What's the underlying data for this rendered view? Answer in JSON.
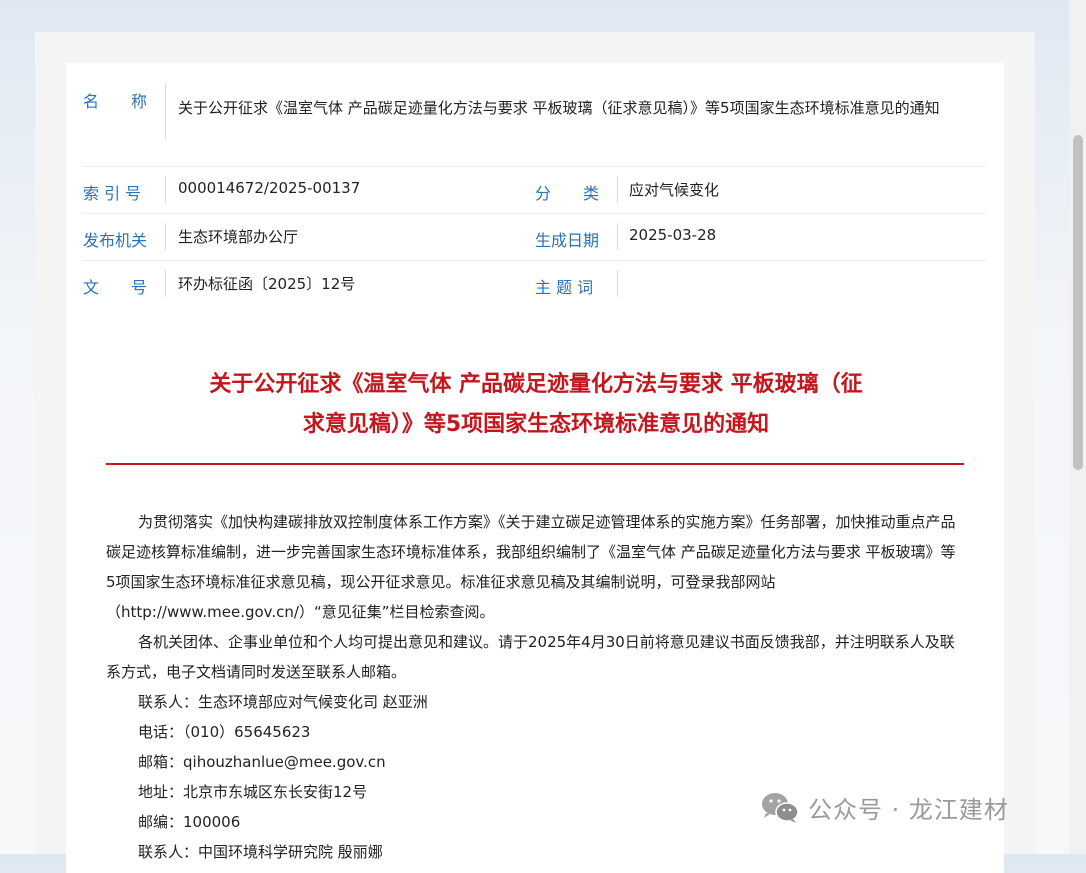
{
  "meta": {
    "name_label": "名　　称",
    "name_value": "关于公开征求《温室气体 产品碳足迹量化方法与要求 平板玻璃（征求意见稿）》等5项国家生态环境标准意见的通知",
    "index_label": "索 引 号",
    "index_value": "000014672/2025-00137",
    "category_label": "分　　类",
    "category_value": "应对气候变化",
    "issuer_label": "发布机关",
    "issuer_value": "生态环境部办公厅",
    "date_label": "生成日期",
    "date_value": "2025-03-28",
    "docno_label": "文　　号",
    "docno_value": "环办标征函〔2025〕12号",
    "subject_label": "主 题 词",
    "subject_value": ""
  },
  "document": {
    "title_line1": "关于公开征求《温室气体 产品碳足迹量化方法与要求 平板玻璃（征",
    "title_line2": "求意见稿）》等5项国家生态环境标准意见的通知",
    "para1": "为贯彻落实《加快构建碳排放双控制度体系工作方案》《关于建立碳足迹管理体系的实施方案》任务部署，加快推动重点产品碳足迹核算标准编制，进一步完善国家生态环境标准体系，我部组织编制了《温室气体 产品碳足迹量化方法与要求 平板玻璃》等5项国家生态环境标准征求意见稿，现公开征求意见。标准征求意见稿及其编制说明，可登录我部网站（http://www.mee.gov.cn/）“意见征集”栏目检索查阅。",
    "para2": "各机关团体、企事业单位和个人均可提出意见和建议。请于2025年4月30日前将意见建议书面反馈我部，并注明联系人及联系方式，电子文档请同时发送至联系人邮箱。",
    "contact1": "联系人：生态环境部应对气候变化司 赵亚洲",
    "phone1": "电话：（010）65645623",
    "email1": "邮箱：qihouzhanlue@mee.gov.cn",
    "address1": "地址：北京市东城区东长安街12号",
    "postcode1": "邮编：100006",
    "contact2": "联系人：中国环境科学研究院 殷丽娜"
  },
  "watermark": {
    "text": "公众号 · 龙江建材",
    "icon": "wechat-icon"
  },
  "colors": {
    "label_blue": "#2b73b5",
    "title_red": "#c4161c"
  }
}
